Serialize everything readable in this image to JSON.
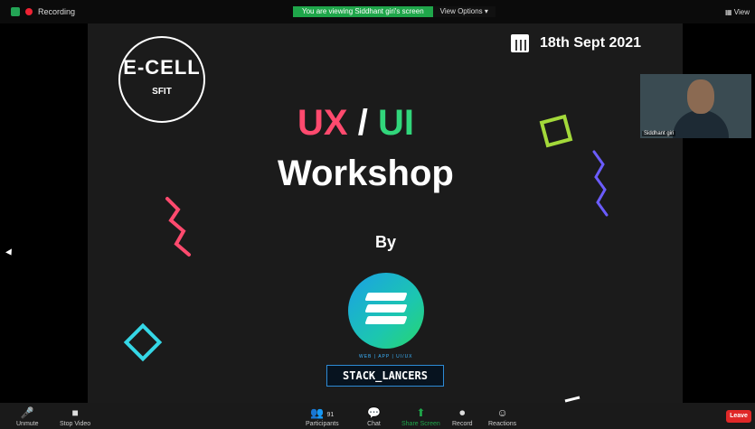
{
  "topbar": {
    "recording_label": "Recording",
    "banner_text": "You are viewing Siddhant giri's screen",
    "view_options": "View Options",
    "view_label": "View"
  },
  "slide": {
    "logo_main": "E-CELL",
    "logo_sub": "SFIT",
    "date": "18th Sept 2021",
    "title_ux": "UX",
    "title_slash": "/",
    "title_ui": "UI",
    "title_workshop": "Workshop",
    "by": "By",
    "stack_tagline": "WEB | APP | UI/UX",
    "stack_name": "STACK_LANCERS"
  },
  "video": {
    "participant_name": "Siddhant giri"
  },
  "toolbar": {
    "unmute": "Unmute",
    "stop_video": "Stop Video",
    "participants": "Participants",
    "participants_count": "91",
    "chat": "Chat",
    "share_screen": "Share Screen",
    "record": "Record",
    "reactions": "Reactions",
    "leave": "Leave"
  },
  "colors": {
    "accent_green": "#1fa64a",
    "ux_pink": "#ff4a6e",
    "ui_green": "#31d67b",
    "leave_red": "#e02828"
  },
  "icons": [
    "shield-icon",
    "record-dot-icon",
    "calendar-icon",
    "mic-icon",
    "video-icon",
    "participants-icon",
    "chat-icon",
    "share-screen-icon",
    "record-icon",
    "reactions-icon"
  ]
}
